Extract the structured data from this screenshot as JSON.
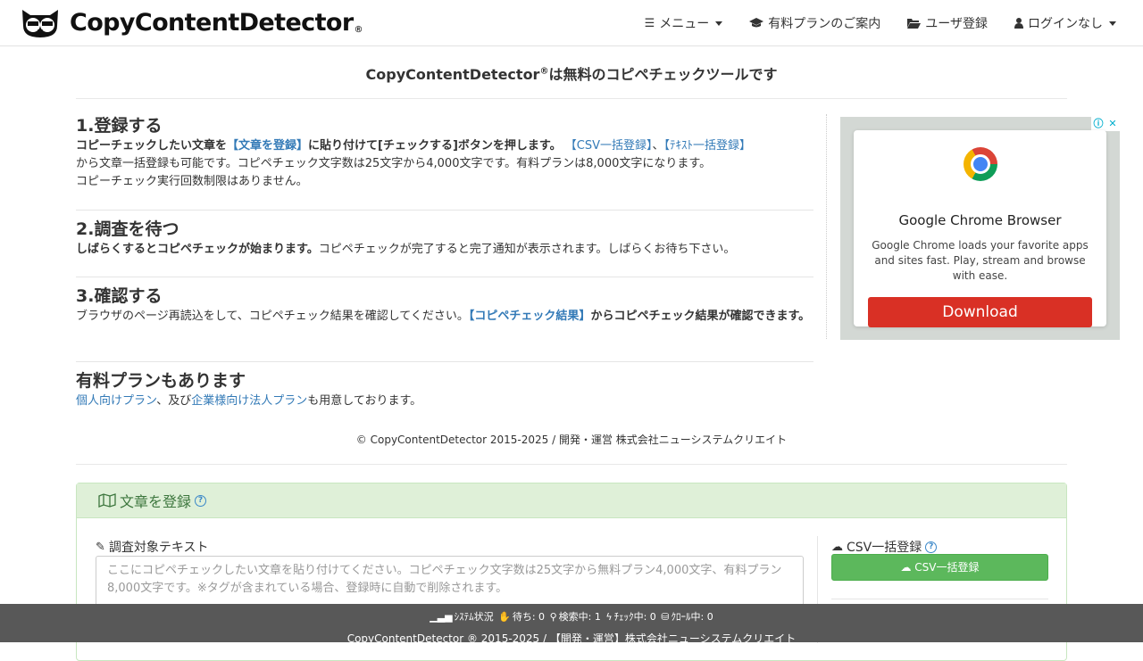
{
  "brand": {
    "name": "CopyContentDetector",
    "reg": "®"
  },
  "nav": {
    "menu": "メニュー",
    "paid_plan": "有料プランのご案内",
    "register": "ユーザ登録",
    "login": "ログインなし"
  },
  "headline": {
    "main": "CopyContentDetector",
    "reg": "®",
    "rest": "は無料のコピペチェックツールです"
  },
  "steps": {
    "s1": {
      "title": "1.登録する",
      "b1": "コピーチェックしたい文章を",
      "link1": "【文章を登録】",
      "b2": "に貼り付けて[チェックする]ボタンを押します。",
      "link2": "【CSV一括登録】",
      "sep": "、",
      "link3": "【ﾃｷｽﾄ一括登録】",
      "line2": "から文章一括登録も可能です。コピペチェック文字数は25文字から4,000文字です。有料プランは8,000文字になります。",
      "line3": "コピーチェック実行回数制限はありません。"
    },
    "s2": {
      "title": "2.調査を待つ",
      "bold": "しばらくするとコピペチェックが始まります。",
      "rest": "コピペチェックが完了すると完了通知が表示されます。しばらくお待ち下さい。"
    },
    "s3": {
      "title": "3.確認する",
      "text": "ブラウザのページ再読込をして、コピペチェック結果を確認してください。",
      "link": "【コピペチェック結果】",
      "bold": "からコピペチェック結果が確認できます。"
    },
    "s4": {
      "title": "有料プランもあります",
      "link1": "個人向けプラン",
      "mid": "、及び",
      "link2": "企業様向け法人プラン",
      "end": "も用意しております。"
    }
  },
  "ad": {
    "title": "Google Chrome Browser",
    "desc": "Google Chrome loads your favorite apps and sites fast. Play, stream and browse with ease.",
    "button": "Download",
    "info": "ⓘ",
    "close": "✕"
  },
  "copyright": "© CopyContentDetector 2015-2025 / 開発・運営 株式会社ニューシステムクリエイト",
  "panel": {
    "title": "文章を登録",
    "help": "?",
    "target_label": "調査対象テキスト",
    "placeholder": "ここにコピペチェックしたい文章を貼り付けてください。コピペチェック文字数は25文字から無料プラン4,000文字、有料プラン8,000文字です。※タグが含まれている場合、登録時に自動で削除されます。",
    "csv_label": "CSV一括登録",
    "csv_button": "CSV一括登録"
  },
  "footer": {
    "status_label": "ｼｽﾃﾑ状況",
    "waiting": "待ち: 0",
    "searching": "検索中: 1",
    "checking": "ﾁｪｯｸ中: 0",
    "crawling": "ｸﾛｰﾙ中: 0",
    "copyright": "CopyContentDetector ® 2015-2025 / 【開発・運営】株式会社ニューシステムクリエイト"
  },
  "colors": {
    "link": "#337ab7",
    "panel_head": "#dff0d8",
    "csv_button": "#5cb85c",
    "ad_button": "#d93025",
    "footer": "#585858"
  }
}
